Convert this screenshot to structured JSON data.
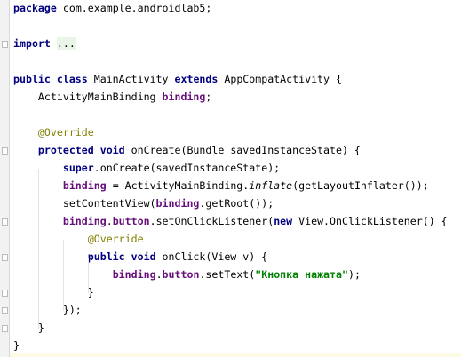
{
  "editor": {
    "lines": [
      [
        {
          "t": "package",
          "c": "kw"
        },
        {
          "t": " com.example.androidlab5;"
        }
      ],
      [],
      [
        {
          "t": "import",
          "c": "kw"
        },
        {
          "t": " "
        },
        {
          "t": "...",
          "c": "fold"
        }
      ],
      [],
      [
        {
          "t": "public class",
          "c": "kw"
        },
        {
          "t": " MainActivity "
        },
        {
          "t": "extends",
          "c": "kw"
        },
        {
          "t": " AppCompatActivity {"
        }
      ],
      [
        {
          "t": "    ActivityMainBinding "
        },
        {
          "t": "binding",
          "c": "fld"
        },
        {
          "t": ";"
        }
      ],
      [],
      [
        {
          "t": "    "
        },
        {
          "t": "@Override",
          "c": "ann"
        }
      ],
      [
        {
          "t": "    "
        },
        {
          "t": "protected void",
          "c": "kw"
        },
        {
          "t": " onCreate(Bundle savedInstanceState) {"
        }
      ],
      [
        {
          "t": "        "
        },
        {
          "t": "super",
          "c": "kw"
        },
        {
          "t": ".onCreate(savedInstanceState);"
        }
      ],
      [
        {
          "t": "        "
        },
        {
          "t": "binding",
          "c": "fld"
        },
        {
          "t": " = ActivityMainBinding."
        },
        {
          "t": "inflate",
          "c": "it"
        },
        {
          "t": "(getLayoutInflater());"
        }
      ],
      [
        {
          "t": "        setContentView("
        },
        {
          "t": "binding",
          "c": "fld"
        },
        {
          "t": ".getRoot());"
        }
      ],
      [
        {
          "t": "        "
        },
        {
          "t": "binding",
          "c": "fld"
        },
        {
          "t": "."
        },
        {
          "t": "button",
          "c": "fld"
        },
        {
          "t": ".setOnClickListener("
        },
        {
          "t": "new",
          "c": "kw"
        },
        {
          "t": " View.OnClickListener() {"
        }
      ],
      [
        {
          "t": "            "
        },
        {
          "t": "@Override",
          "c": "ann"
        }
      ],
      [
        {
          "t": "            "
        },
        {
          "t": "public void",
          "c": "kw"
        },
        {
          "t": " onClick(View v) {"
        }
      ],
      [
        {
          "t": "                "
        },
        {
          "t": "binding",
          "c": "fld"
        },
        {
          "t": "."
        },
        {
          "t": "button",
          "c": "fld"
        },
        {
          "t": ".setText("
        },
        {
          "t": "\"Кнопка нажата\"",
          "c": "str"
        },
        {
          "t": ");"
        }
      ],
      [
        {
          "t": "            }"
        }
      ],
      [
        {
          "t": "        });"
        }
      ],
      [
        {
          "t": "    }"
        }
      ],
      [
        {
          "t": "}"
        }
      ]
    ]
  }
}
